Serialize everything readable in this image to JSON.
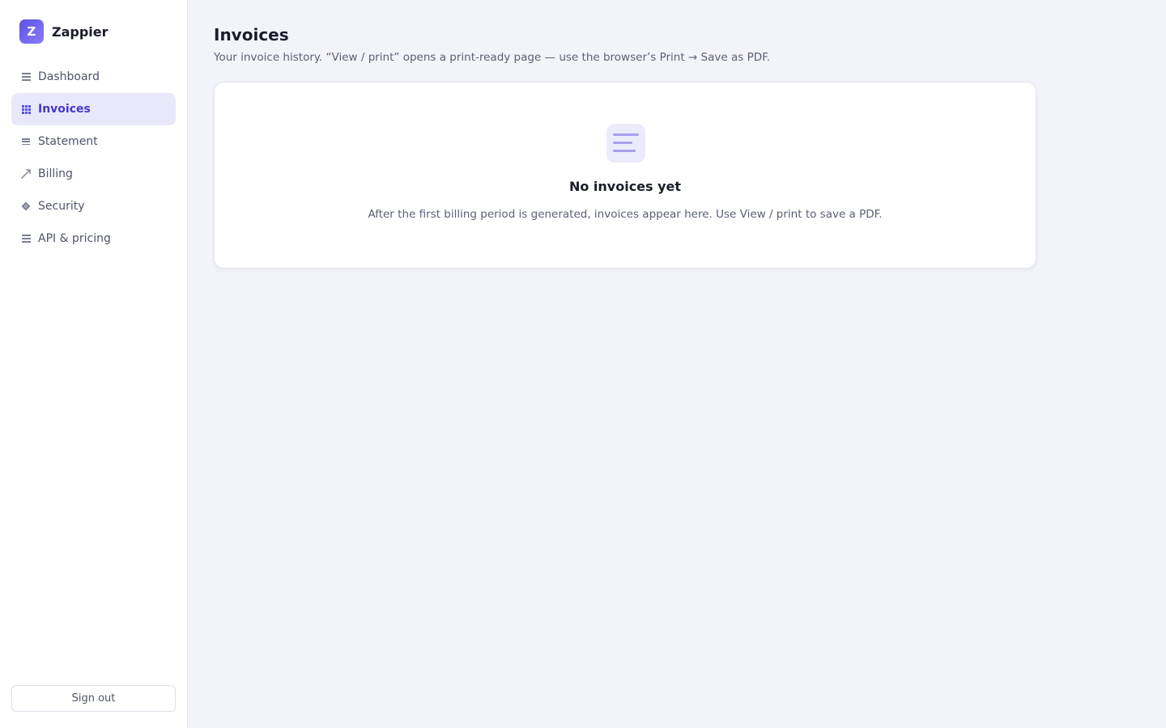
{
  "app": {
    "logo_letter": "Z",
    "name": "Zappier"
  },
  "sidebar": {
    "items": [
      {
        "label": "Dashboard",
        "icon": "dashboard-icon"
      },
      {
        "label": "Invoices",
        "icon": "invoices-grid-icon",
        "active": true
      },
      {
        "label": "Statement",
        "icon": "statement-lines-icon"
      },
      {
        "label": "Billing",
        "icon": "billing-arrow-icon"
      },
      {
        "label": "Security",
        "icon": "security-diamond-icon"
      },
      {
        "label": "API & pricing",
        "icon": "api-icon"
      }
    ],
    "signout_label": "Sign out"
  },
  "main": {
    "title": "Invoices",
    "subtitle": "Your invoice history. “View / print” opens a print-ready page — use the browser’s Print → Save as PDF.",
    "empty_state": {
      "icon": "document-lines-icon",
      "title": "No invoices yet",
      "description": "After the first billing period is generated, invoices appear here. Use View / print to save a PDF."
    }
  },
  "colors": {
    "accent": "#5b4fe0",
    "active_nav_bg": "#e9e8fb",
    "page_bg": "#f3f4f9"
  }
}
